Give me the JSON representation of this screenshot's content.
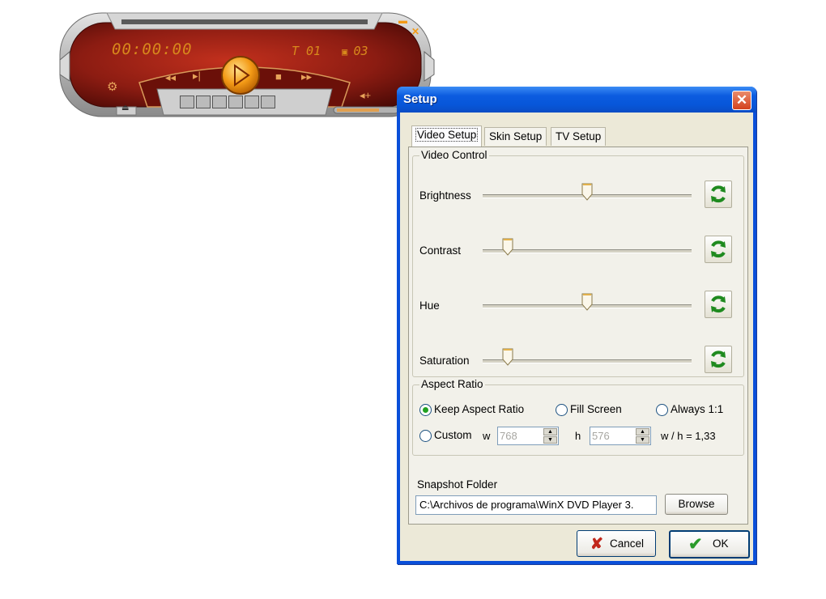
{
  "player": {
    "time": "00:00:00",
    "title_indicator": "T 01",
    "chapter_indicator": "03",
    "colors": {
      "body": "#8c1c12",
      "accent": "#d8891c",
      "frame": "#c9c9c9",
      "play": "#f39a16"
    },
    "icons": [
      "play-icon",
      "rewind-icon",
      "step-icon",
      "stop-icon",
      "fast-forward-icon",
      "eject-icon",
      "settings-icon",
      "volume-icon",
      "minimize-icon",
      "close-icon"
    ]
  },
  "dialog": {
    "title": "Setup",
    "close_icon": "close-icon",
    "tabs": [
      {
        "label": "Video Setup",
        "active": true
      },
      {
        "label": "Skin Setup",
        "active": false
      },
      {
        "label": "TV Setup",
        "active": false
      }
    ],
    "video_control": {
      "legend": "Video Control",
      "sliders": [
        {
          "label": "Brightness",
          "value": 0.5
        },
        {
          "label": "Contrast",
          "value": 0.12
        },
        {
          "label": "Hue",
          "value": 0.5
        },
        {
          "label": "Saturation",
          "value": 0.12
        }
      ],
      "reset_icon": "refresh-icon"
    },
    "aspect_ratio": {
      "legend": "Aspect Ratio",
      "options": {
        "keep": "Keep Aspect Ratio",
        "fill": "Fill Screen",
        "always": "Always 1:1",
        "custom": "Custom"
      },
      "selected": "keep",
      "w_label": "w",
      "w_value": "768",
      "h_label": "h",
      "h_value": "576",
      "ratio": "w / h = 1,33"
    },
    "snapshot": {
      "label": "Snapshot Folder",
      "path": "C:\\Archivos de programa\\WinX DVD Player 3.",
      "browse": "Browse"
    },
    "buttons": {
      "cancel": "Cancel",
      "ok": "OK"
    },
    "colors": {
      "titlebar": "#0756d9",
      "face": "#ece9d8",
      "cancel_icon": "#c1271b",
      "ok_icon": "#2a9a2a"
    }
  }
}
